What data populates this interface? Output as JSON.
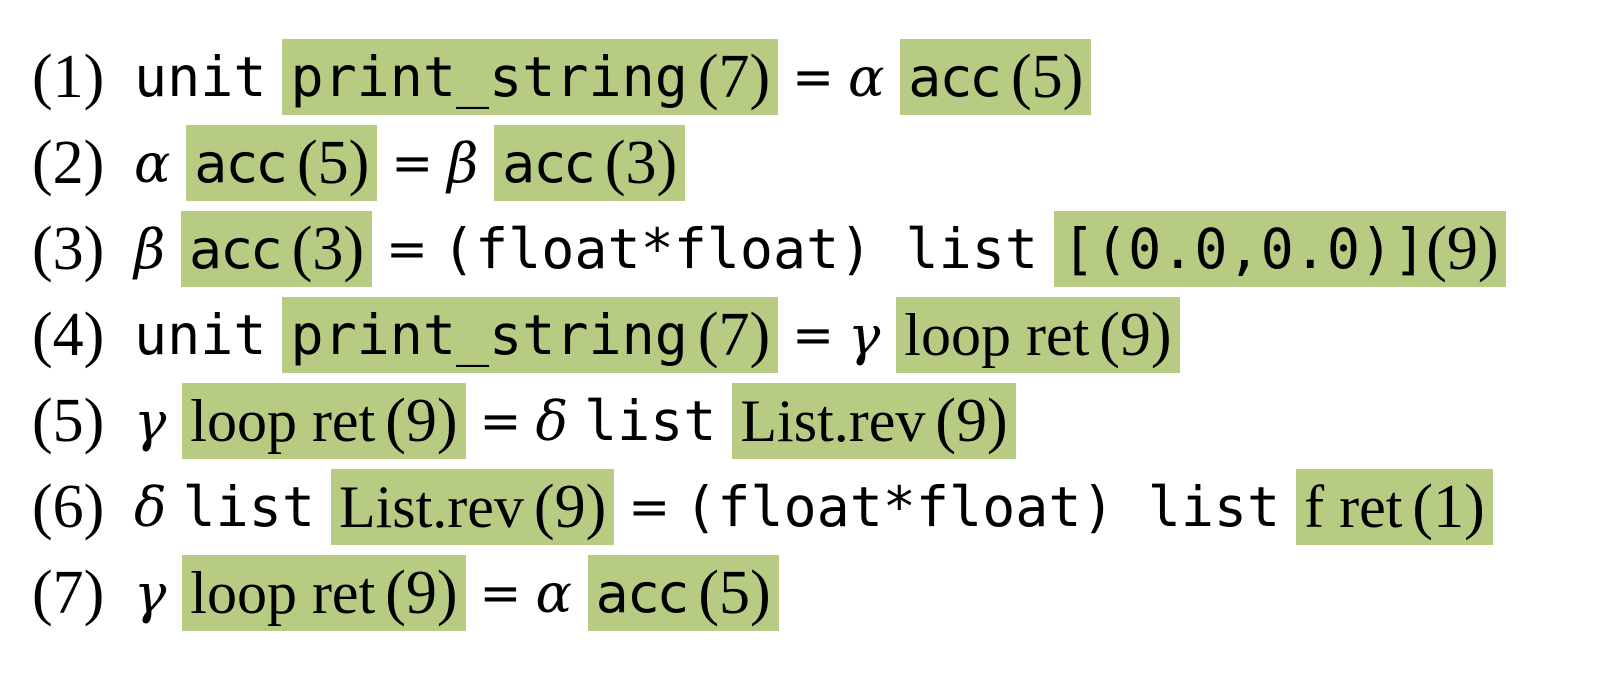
{
  "equations": [
    {
      "num": "(1)",
      "lhs_type": "unit",
      "lhs_label": "print_string",
      "lhs_loc": "(7)",
      "rhs_type": "α",
      "rhs_label": "acc",
      "rhs_loc": "(5)"
    },
    {
      "num": "(2)",
      "lhs_type": "α",
      "lhs_label": "acc",
      "lhs_loc": "(5)",
      "rhs_type": "β",
      "rhs_label": "acc",
      "rhs_loc": "(3)"
    },
    {
      "num": "(3)",
      "lhs_type": "β",
      "lhs_label": "acc",
      "lhs_loc": "(3)",
      "rhs_type": "(float*float) list",
      "rhs_label": "[(0.0,0.0)]",
      "rhs_loc": "(9)"
    },
    {
      "num": "(4)",
      "lhs_type": "unit",
      "lhs_label": "print_string",
      "lhs_loc": "(7)",
      "rhs_type": "γ",
      "rhs_label": "loop ret",
      "rhs_loc": "(9)"
    },
    {
      "num": "(5)",
      "lhs_type": "γ",
      "lhs_label": "loop ret",
      "lhs_loc": "(9)",
      "rhs_type_var": "δ",
      "rhs_type": "list",
      "rhs_label": "List.rev",
      "rhs_loc": "(9)"
    },
    {
      "num": "(6)",
      "lhs_type_var": "δ",
      "lhs_type": "list",
      "lhs_label": "List.rev",
      "lhs_loc": "(9)",
      "rhs_type": "(float*float) list",
      "rhs_label": "f ret",
      "rhs_loc": "(1)"
    },
    {
      "num": "(7)",
      "lhs_type": "γ",
      "lhs_label": "loop ret",
      "lhs_loc": "(9)",
      "rhs_type": "α",
      "rhs_label": "acc",
      "rhs_loc": "(5)"
    }
  ],
  "equals": "=",
  "highlight_color": "#b7cb83"
}
